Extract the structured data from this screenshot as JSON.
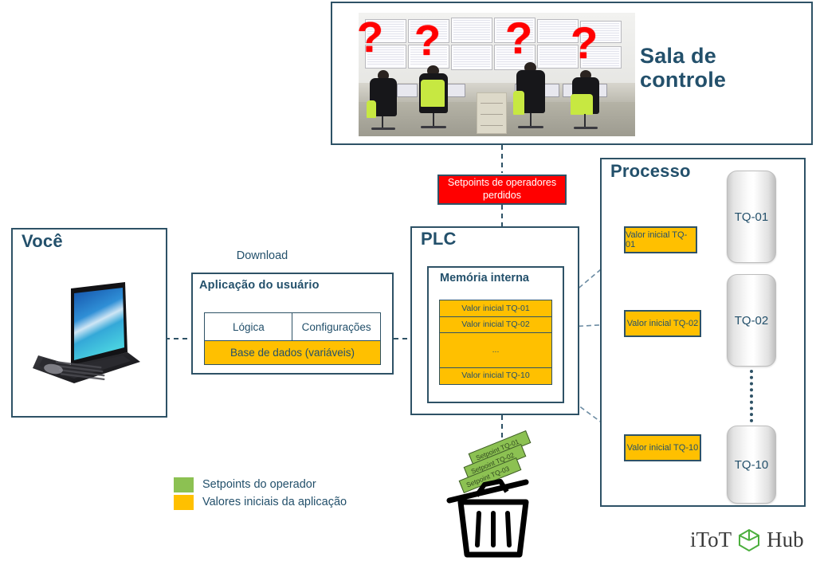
{
  "diagram": {
    "title_text_color": "#23506B",
    "accent_orange": "#FFC000",
    "accent_green": "#8CC152",
    "alert_red": "#FF0000",
    "border_navy": "#2E5266"
  },
  "control_room": {
    "title": "Sala de controle",
    "photo_alt": "control-room-photo",
    "question_marks": [
      "?",
      "?",
      "?",
      "?"
    ]
  },
  "alert": {
    "text": "Setpoints de operadores perdidos"
  },
  "plc": {
    "title": "PLC",
    "memory": {
      "title": "Memória interna",
      "rows": [
        {
          "label": "Valor inicial TQ-01"
        },
        {
          "label": "Valor inicial TQ-02"
        },
        {
          "label": "..."
        },
        {
          "label": "Valor inicial TQ-10"
        }
      ]
    }
  },
  "processo": {
    "title": "Processo",
    "tanks": [
      {
        "label": "TQ-01"
      },
      {
        "label": "TQ-02"
      },
      {
        "label": "TQ-10"
      }
    ],
    "value_boxes": [
      {
        "label": "Valor inicial TQ-01"
      },
      {
        "label": "Valor inicial TQ-02"
      },
      {
        "label": "Valor inicial TQ-10"
      }
    ]
  },
  "voce": {
    "title": "Você",
    "device": "laptop"
  },
  "application": {
    "download_label": "Download",
    "title": "Aplicação do usuário",
    "cells": [
      {
        "label": "Lógica"
      },
      {
        "label": "Configurações"
      }
    ],
    "database": "Base de dados (variáveis)"
  },
  "legend": {
    "items": [
      {
        "color": "#8CC152",
        "label": "Setpoints do operador"
      },
      {
        "color": "#FFC000",
        "label": "Valores iniciais da aplicação"
      }
    ]
  },
  "trash": {
    "tickets": [
      {
        "label": "Setpoint TQ-01"
      },
      {
        "label": "Setpoint TQ-02"
      },
      {
        "label": "Setpoint TQ-03"
      }
    ]
  },
  "logo": {
    "left_text": "iToT",
    "right_text": "Hub",
    "mark": "cube-icon"
  }
}
